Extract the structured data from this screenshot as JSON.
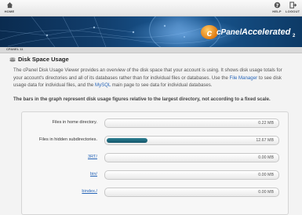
{
  "topbar": {
    "home": "HOME",
    "help": "HELP",
    "logout": "LOGOUT"
  },
  "banner": {
    "brand_cp": "cPanel",
    "brand_accelerated": "Accelerated",
    "brand_version": "2"
  },
  "subbar": {
    "label": "CPANEL 11"
  },
  "page": {
    "title": "Disk Space Usage",
    "desc_part1": "The cPanel Disk Usage Viewer provides an overview of the disk space that your account is using. It shows disk usage totals for your account's directories and all of its databases rather than for individual files or databases. Use the ",
    "link_file_manager": "File Manager",
    "desc_part2": " to see disk usage data for individual files, and the ",
    "link_mysql": "MySQL",
    "desc_part3": " main page to see data for individual databases.",
    "note": "The bars in the graph represent disk usage figures relative to the largest directory, not according to a fixed scale."
  },
  "usage": {
    "rows": [
      {
        "label": "Files in home directory.",
        "size": "0.22 MB",
        "fraction": 0
      },
      {
        "label": "Files in hidden subdirectories.",
        "size": "12.67 MB",
        "fraction": 0.24
      },
      {
        "label": "3RT/",
        "size": "0.00 MB",
        "fraction": 0
      },
      {
        "label": "bin/",
        "size": "0.00 MB",
        "fraction": 0
      },
      {
        "label": "bindex./",
        "size": "0.00 MB",
        "fraction": 0
      }
    ]
  },
  "colors": {
    "accent_bar": "#1f6b80",
    "link": "#2866b8",
    "banner": "#123f6e"
  }
}
